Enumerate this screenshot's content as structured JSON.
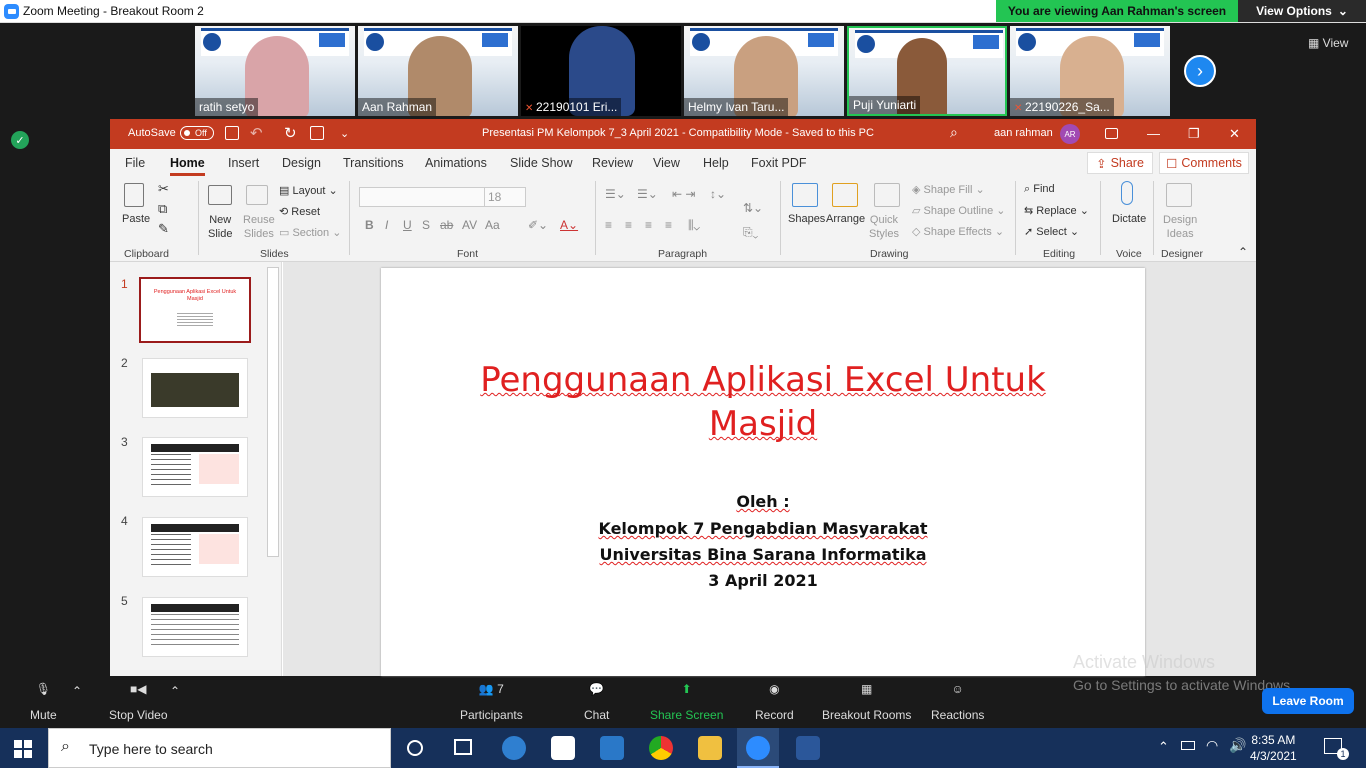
{
  "zoom": {
    "window_title": "Zoom Meeting - Breakout Room 2",
    "viewing_banner": "You are viewing Aan Rahman's screen",
    "view_options": "View Options",
    "view_label": "View",
    "participants": [
      {
        "name": "ratih setyo",
        "muted": false
      },
      {
        "name": "Aan Rahman",
        "muted": false
      },
      {
        "name": "22190101 Eri...",
        "muted": true
      },
      {
        "name": "Helmy Ivan Taru...",
        "muted": false
      },
      {
        "name": "Puji Yuniarti",
        "muted": false
      },
      {
        "name": "22190226_Sa...",
        "muted": true
      }
    ],
    "toolbar": {
      "mute": "Mute",
      "stop_video": "Stop Video",
      "participants": "Participants",
      "participants_count": "7",
      "chat": "Chat",
      "share_screen": "Share Screen",
      "record": "Record",
      "breakout_rooms": "Breakout Rooms",
      "reactions": "Reactions",
      "leave": "Leave Room"
    }
  },
  "ppt": {
    "autosave": "AutoSave",
    "autosave_state": "Off",
    "doc_title": "Presentasi PM Kelompok 7_3 April 2021  -  Compatibility Mode  -  Saved to this PC",
    "user": "aan rahman",
    "user_initials": "AR",
    "menu": [
      "File",
      "Home",
      "Insert",
      "Design",
      "Transitions",
      "Animations",
      "Slide Show",
      "Review",
      "View",
      "Help",
      "Foxit PDF"
    ],
    "share": "Share",
    "comments": "Comments",
    "ribbon": {
      "paste": "Paste",
      "clipboard": "Clipboard",
      "new_slide_1": "New",
      "new_slide_2": "Slide",
      "reuse_1": "Reuse",
      "reuse_2": "Slides",
      "layout": "Layout",
      "reset": "Reset",
      "section": "Section",
      "slides": "Slides",
      "font_size": "18",
      "font": "Font",
      "paragraph": "Paragraph",
      "shapes": "Shapes",
      "arrange": "Arrange",
      "quick_1": "Quick",
      "quick_2": "Styles",
      "shape_fill": "Shape Fill",
      "shape_outline": "Shape Outline",
      "shape_effects": "Shape Effects",
      "drawing": "Drawing",
      "find": "Find",
      "replace": "Replace",
      "select": "Select",
      "editing": "Editing",
      "dictate": "Dictate",
      "voice": "Voice",
      "design_1": "Design",
      "design_2": "Ideas",
      "designer": "Designer"
    },
    "thumbnails": [
      "1",
      "2",
      "3",
      "4",
      "5"
    ],
    "thumb1_title": "Penggunaan Aplikasi Excel Untuk Masjid",
    "slide": {
      "title_line1": "Penggunaan Aplikasi Excel Untuk",
      "title_line2": "Masjid",
      "by": "Oleh :",
      "group": "Kelompok 7 Pengabdian Masyarakat",
      "university": "Universitas Bina Sarana Informatika",
      "date": "3 April 2021"
    }
  },
  "activate_windows": {
    "title": "Activate Windows",
    "subtitle": "Go to Settings to activate Windows."
  },
  "taskbar": {
    "search_placeholder": "Type here to search",
    "time": "8:35 AM",
    "date": "4/3/2021",
    "notifications": "1"
  },
  "colors": {
    "ppt_accent": "#c33b20",
    "zoom_green": "#23c553",
    "zoom_blue": "#0e72ed",
    "slide_title": "#e02020"
  }
}
